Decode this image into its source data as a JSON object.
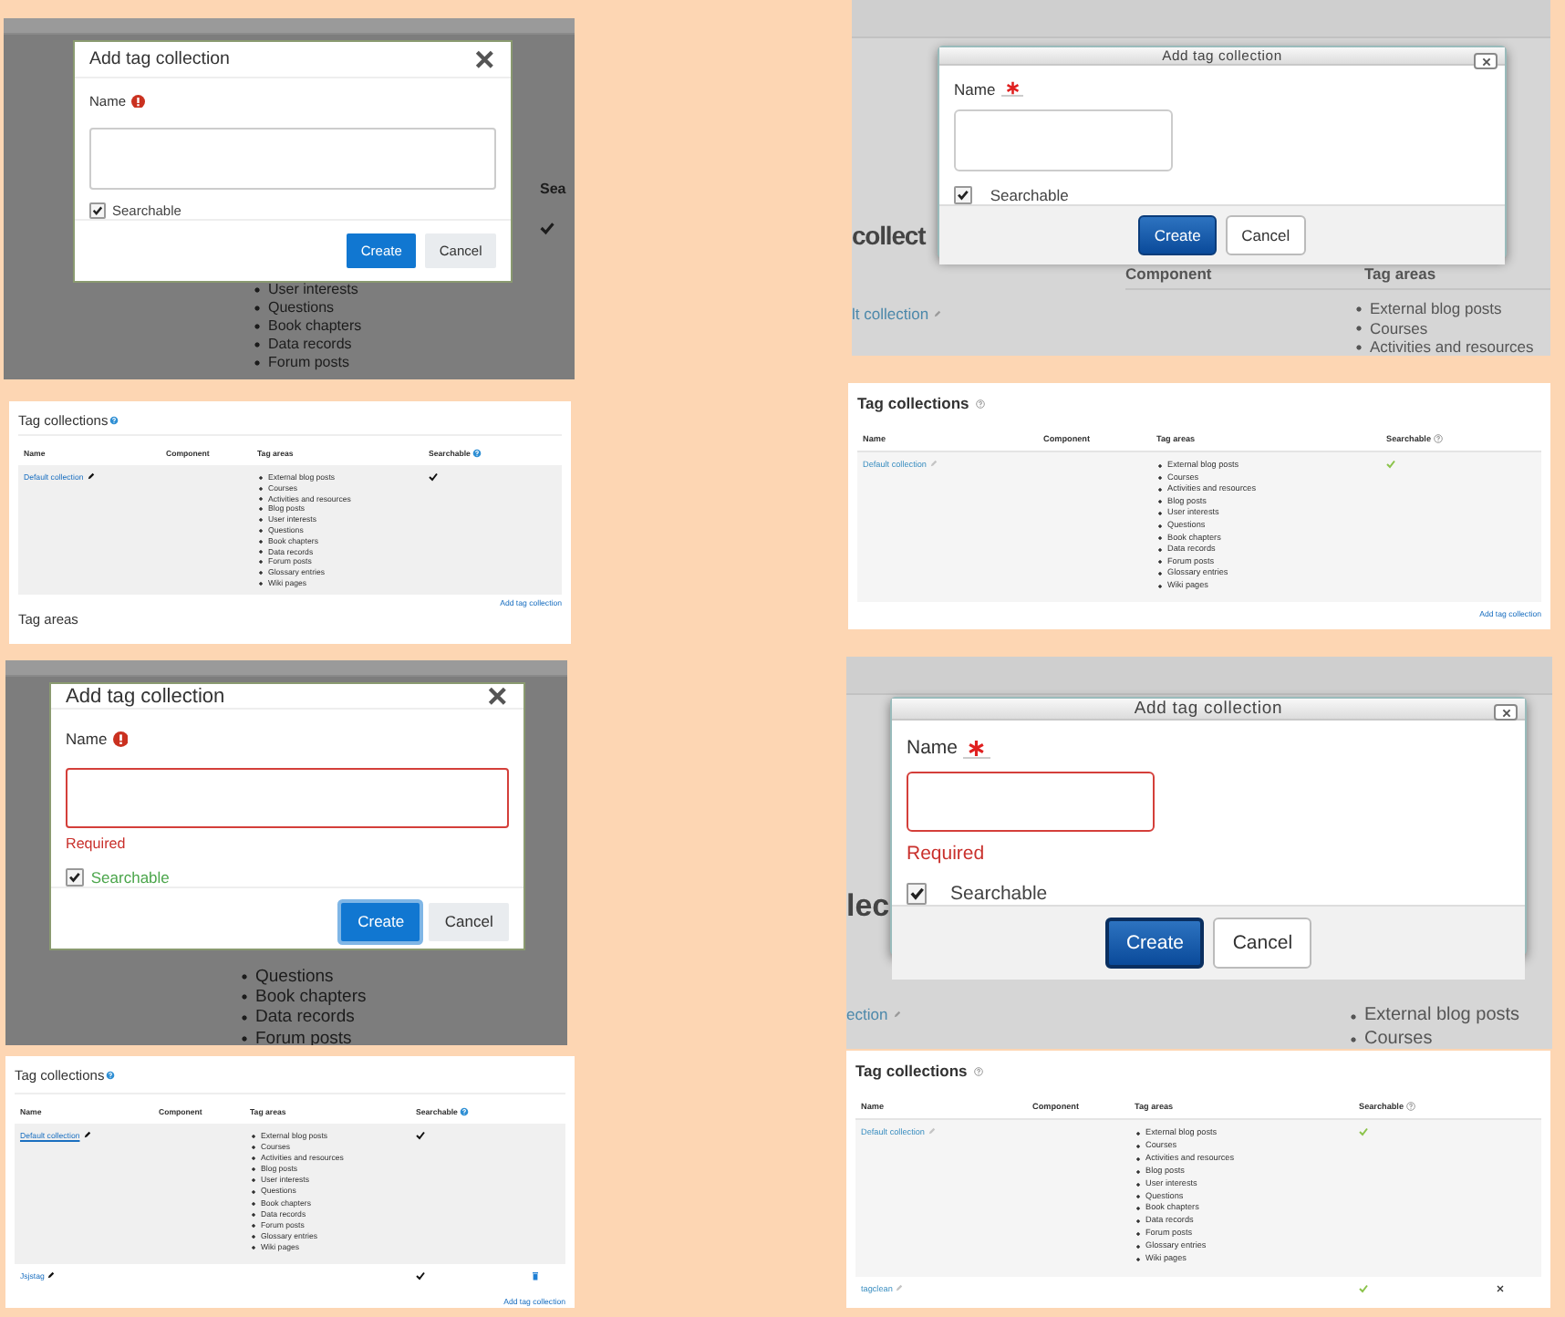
{
  "panels": [
    {
      "kind": "flatdialog",
      "backdrop": {
        "searchable_header": "Sea",
        "searchable": true,
        "list": [
          "User interests",
          "Questions",
          "Book chapters",
          "Data records",
          "Forum posts"
        ]
      },
      "dialog": {
        "title": "Add tag collection",
        "name_label": "Name",
        "required": true,
        "invalid": false,
        "searchable_label": "Searchable",
        "searchable_checked": true,
        "label_valid": false,
        "buttons": [
          {
            "label": "Create",
            "kind": "primary",
            "focused": false
          },
          {
            "label": "Cancel",
            "kind": "secondary",
            "focused": false
          }
        ]
      }
    },
    {
      "kind": "windowdialog",
      "backdrop": {
        "heading": "collect",
        "component_header": "Component",
        "areas_header": "Tag areas",
        "link": "lt collection",
        "editable": true,
        "list": [
          "External blog posts",
          "Courses",
          "Activities and resources"
        ]
      },
      "dialog": {
        "title": "Add tag collection",
        "name_label": "Name",
        "required": true,
        "invalid": false,
        "searchable_label": "Searchable",
        "searchable_checked": true,
        "label_valid": false,
        "buttons": [
          {
            "label": "Create",
            "kind": "primary",
            "focused": false
          },
          {
            "label": "Cancel",
            "kind": "secondary",
            "focused": false
          }
        ]
      }
    },
    {
      "kind": "flattable",
      "title": "Tag collections",
      "columns": [
        "Name",
        "Component",
        "Tag areas",
        "Searchable"
      ],
      "rows": [
        {
          "name": "Default collection",
          "focused": false,
          "editable": true,
          "areas": [
            "External blog posts",
            "Courses",
            "Activities and resources",
            "Blog posts",
            "User interests",
            "Questions",
            "Book chapters",
            "Data records",
            "Forum posts",
            "Glossary entries",
            "Wiki pages"
          ],
          "searchable": true,
          "deletable": false
        }
      ],
      "footer_link": "Add tag collection",
      "next_heading": "Tag areas"
    },
    {
      "kind": "plaintable",
      "title": "Tag collections",
      "columns": [
        "Name",
        "Component",
        "Tag areas",
        "Searchable"
      ],
      "rows": [
        {
          "name": "Default collection",
          "focused": false,
          "editable": true,
          "areas": [
            "External blog posts",
            "Courses",
            "Activities and resources",
            "Blog posts",
            "User interests",
            "Questions",
            "Book chapters",
            "Data records",
            "Forum posts",
            "Glossary entries",
            "Wiki pages"
          ],
          "searchable": true,
          "deletable": false
        }
      ],
      "footer_link": "Add tag collection"
    },
    {
      "kind": "flatdialog",
      "backdrop": {
        "list": [
          "Questions",
          "Book chapters",
          "Data records",
          "Forum posts"
        ]
      },
      "dialog": {
        "title": "Add tag collection",
        "name_label": "Name",
        "required": true,
        "invalid": true,
        "error": "Required",
        "searchable_label": "Searchable",
        "searchable_checked": true,
        "label_valid": true,
        "buttons": [
          {
            "label": "Create",
            "kind": "primary",
            "focused": true
          },
          {
            "label": "Cancel",
            "kind": "secondary",
            "focused": false
          }
        ]
      }
    },
    {
      "kind": "windowdialog",
      "backdrop": {
        "heading": "lec",
        "link": "ection",
        "editable": true,
        "list": [
          "External blog posts",
          "Courses"
        ]
      },
      "dialog": {
        "title": "Add tag collection",
        "name_label": "Name",
        "required": true,
        "invalid": true,
        "error": "Required",
        "searchable_label": "Searchable",
        "searchable_checked": true,
        "label_valid": false,
        "buttons": [
          {
            "label": "Create",
            "kind": "primary",
            "focused": true
          },
          {
            "label": "Cancel",
            "kind": "secondary",
            "focused": false
          }
        ]
      }
    },
    {
      "kind": "flattable",
      "title": "Tag collections",
      "columns": [
        "Name",
        "Component",
        "Tag areas",
        "Searchable"
      ],
      "rows": [
        {
          "name": "Default collection",
          "focused": true,
          "editable": true,
          "areas": [
            "External blog posts",
            "Courses",
            "Activities and resources",
            "Blog posts",
            "User interests",
            "Questions",
            "Book chapters",
            "Data records",
            "Forum posts",
            "Glossary entries",
            "Wiki pages"
          ],
          "searchable": true,
          "deletable": false
        },
        {
          "name": "Jsjstag",
          "focused": false,
          "editable": true,
          "searchable": true,
          "deletable": true
        }
      ],
      "footer_link": "Add tag collection"
    },
    {
      "kind": "plaintable",
      "title": "Tag collections",
      "columns": [
        "Name",
        "Component",
        "Tag areas",
        "Searchable"
      ],
      "rows": [
        {
          "name": "Default collection",
          "focused": false,
          "editable": true,
          "areas": [
            "External blog posts",
            "Courses",
            "Activities and resources",
            "Blog posts",
            "User interests",
            "Questions",
            "Book chapters",
            "Data records",
            "Forum posts",
            "Glossary entries",
            "Wiki pages"
          ],
          "searchable": true,
          "deletable": false
        },
        {
          "name": "tagclean",
          "focused": false,
          "editable": true,
          "searchable": true,
          "deletable": true
        }
      ]
    }
  ]
}
